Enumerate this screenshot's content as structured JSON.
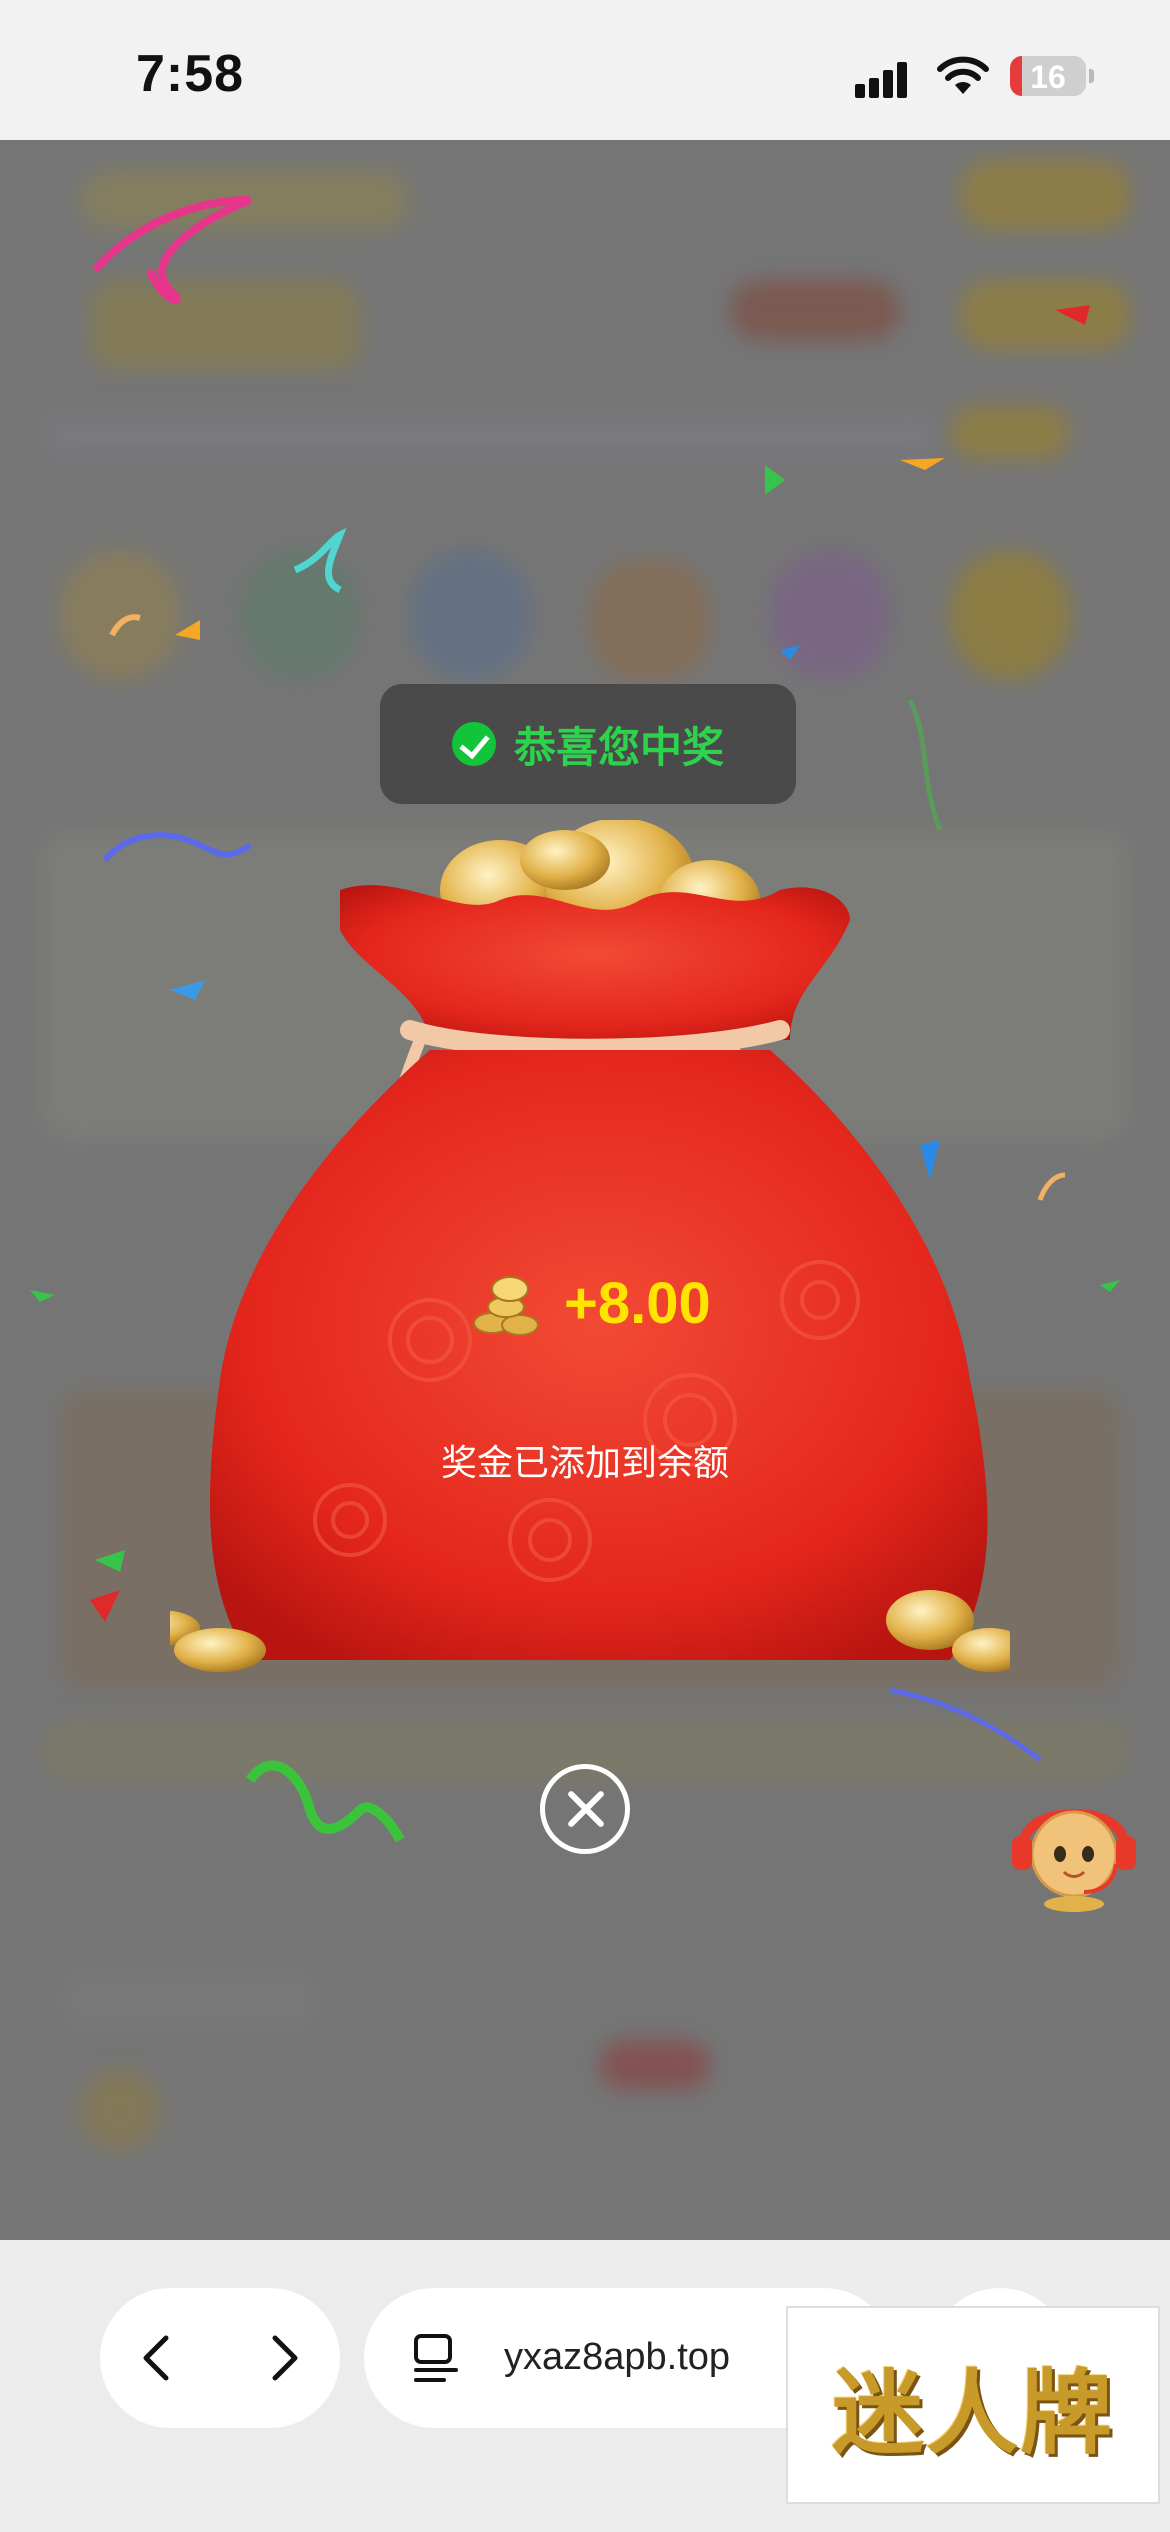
{
  "status_bar": {
    "time": "7:58",
    "battery": "16"
  },
  "toast": {
    "icon": "check-circle-icon",
    "text": "恭喜您中奖"
  },
  "reward": {
    "amount": "+8.00",
    "note": "奖金已添加到余额"
  },
  "browser": {
    "url": "yxaz8apb.top",
    "back_icon": "chevron-left-icon",
    "forward_icon": "chevron-right-icon",
    "tabs_icon": "tabs-icon"
  },
  "watermark": {
    "text": "迷人牌"
  },
  "colors": {
    "bag_red": "#e8281f",
    "toast_bg": "#4a4a4a",
    "toast_text": "#2bd44a",
    "reward_yellow": "#ffe400"
  }
}
